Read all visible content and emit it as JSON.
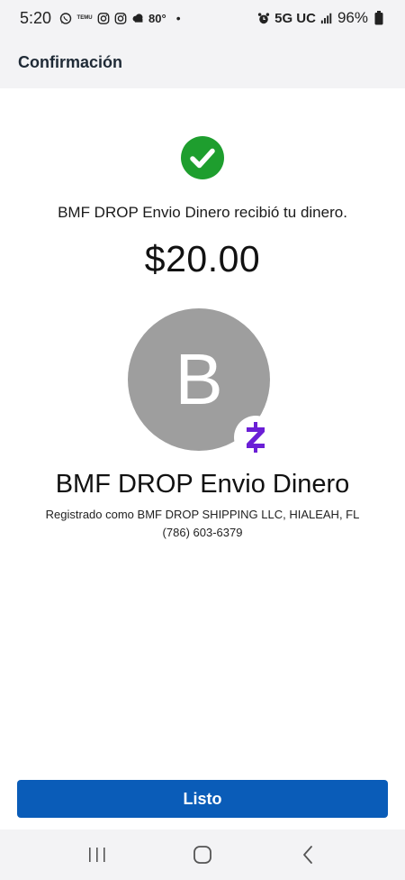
{
  "status_bar": {
    "time": "5:20",
    "notification_icons": [
      "whatsapp-icon",
      "temu-icon",
      "instagram-icon",
      "instagram-icon",
      "weather-icon"
    ],
    "temu_label": "TEMU",
    "temperature": "80°",
    "dot": "•",
    "alarm_icon": "alarm-icon",
    "network": "5G UC",
    "signal_icon": "signal-icon",
    "battery_percent": "96%",
    "battery_icon": "battery-icon"
  },
  "header": {
    "title": "Confirmación"
  },
  "confirmation": {
    "status_icon": "check-circle-icon",
    "message": "BMF DROP Envio Dinero recibió tu dinero.",
    "amount": "$20.00"
  },
  "recipient": {
    "avatar_letter": "B",
    "badge_icon": "zelle-icon",
    "name": "BMF DROP Envio Dinero",
    "registered": "Registrado como BMF DROP SHIPPING LLC, HIALEAH, FL",
    "phone": "(786) 603-6379"
  },
  "actions": {
    "done_label": "Listo"
  },
  "nav": {
    "recents_icon": "recent-apps-icon",
    "home_icon": "home-icon",
    "back_icon": "back-icon"
  },
  "colors": {
    "check_green": "#1e9e2e",
    "avatar_gray": "#9e9e9e",
    "zelle_purple": "#6b1fd6",
    "button_blue": "#0a5cb8",
    "header_bg": "#f3f3f5"
  }
}
